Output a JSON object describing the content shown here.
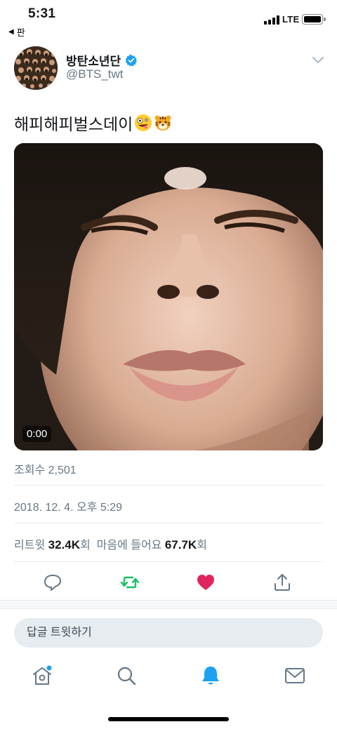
{
  "status_bar": {
    "time": "5:31",
    "back_app": "판",
    "network": "LTE"
  },
  "tweet": {
    "display_name": "방탄소년단",
    "handle": "@BTS_twt",
    "text": "해피해피벌스데이",
    "emojis": [
      "zany-face-emoji",
      "tiger-face-emoji"
    ],
    "video_duration": "0:00",
    "views": "조회수 2,501",
    "timestamp": "2018. 12. 4. 오후 5:29",
    "retweets_label": "리트윗",
    "retweets_count": "32.4K",
    "retweets_unit": "회",
    "likes_label": "마음에 들어요",
    "likes_count": "67.7K",
    "likes_unit": "회",
    "liked": true
  },
  "reply": {
    "placeholder": "답글 트윗하기"
  },
  "colors": {
    "brand_blue": "#1da1f2",
    "retweet_green": "#17bf63",
    "like_red": "#e0245e",
    "secondary_text": "#657786"
  },
  "icons": {
    "actions": [
      "reply-icon",
      "retweet-icon",
      "like-icon",
      "share-icon"
    ],
    "tabs": [
      "home-icon",
      "search-icon",
      "notifications-icon",
      "messages-icon"
    ]
  }
}
